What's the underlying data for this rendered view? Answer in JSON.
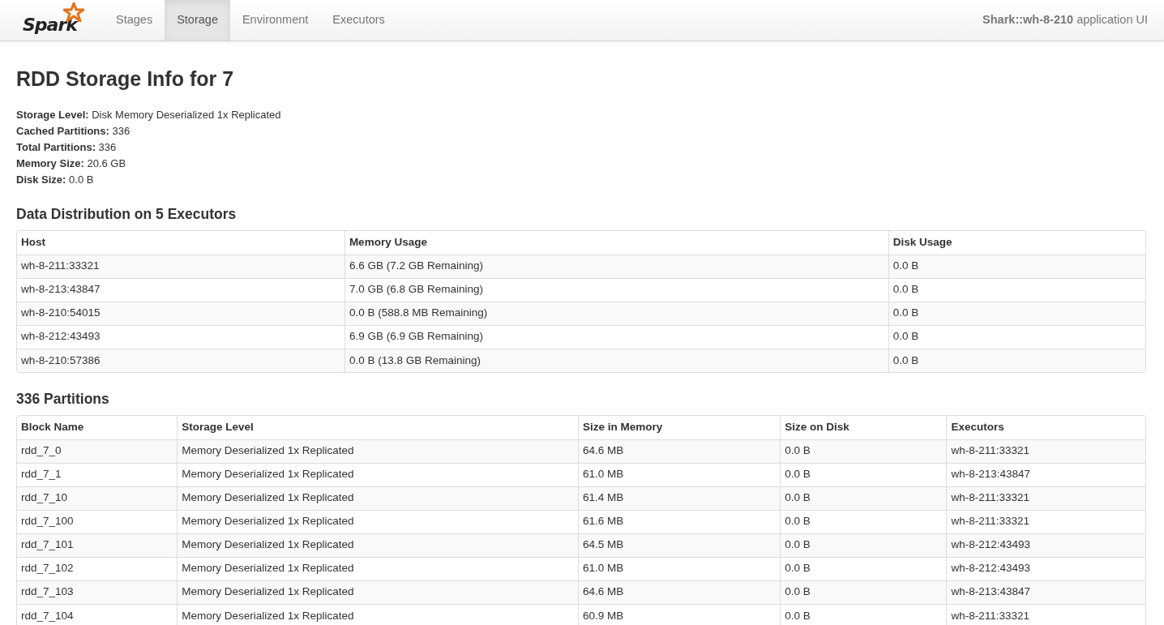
{
  "navbar": {
    "brand": "Spark",
    "tabs": [
      {
        "label": "Stages",
        "selected": false
      },
      {
        "label": "Storage",
        "selected": true
      },
      {
        "label": "Environment",
        "selected": false
      },
      {
        "label": "Executors",
        "selected": false
      }
    ],
    "app_title": "**Shark::wh-8-210** application UI"
  },
  "title": "RDD Storage Info for 7",
  "summary": [
    {
      "label": "Storage Level:",
      "value": "Disk Memory Deserialized 1x Replicated"
    },
    {
      "label": "Cached Partitions:",
      "value": "336"
    },
    {
      "label": "Total Partitions:",
      "value": "336"
    },
    {
      "label": "Memory Size:",
      "value": "20.6 GB"
    },
    {
      "label": "Disk Size:",
      "value": "0.0 B"
    }
  ],
  "executors_table": {
    "heading": "Data Distribution on 5 Executors",
    "columns": [
      "Host",
      "Memory Usage",
      "Disk Usage"
    ],
    "rows": [
      [
        "wh-8-211:33321",
        "6.6 GB (7.2 GB Remaining)",
        "0.0 B"
      ],
      [
        "wh-8-213:43847",
        "7.0 GB (6.8 GB Remaining)",
        "0.0 B"
      ],
      [
        "wh-8-210:54015",
        "0.0 B (588.8 MB Remaining)",
        "0.0 B"
      ],
      [
        "wh-8-212:43493",
        "6.9 GB (6.9 GB Remaining)",
        "0.0 B"
      ],
      [
        "wh-8-210:57386",
        "0.0 B (13.8 GB Remaining)",
        "0.0 B"
      ]
    ]
  },
  "partitions_table": {
    "heading": "336 Partitions",
    "columns": [
      "Block Name",
      "Storage Level",
      "Size in Memory",
      "Size on Disk",
      "Executors"
    ],
    "rows": [
      [
        "rdd_7_0",
        "Memory Deserialized 1x Replicated",
        "64.6 MB",
        "0.0 B",
        "wh-8-211:33321"
      ],
      [
        "rdd_7_1",
        "Memory Deserialized 1x Replicated",
        "61.0 MB",
        "0.0 B",
        "wh-8-213:43847"
      ],
      [
        "rdd_7_10",
        "Memory Deserialized 1x Replicated",
        "61.4 MB",
        "0.0 B",
        "wh-8-211:33321"
      ],
      [
        "rdd_7_100",
        "Memory Deserialized 1x Replicated",
        "61.6 MB",
        "0.0 B",
        "wh-8-211:33321"
      ],
      [
        "rdd_7_101",
        "Memory Deserialized 1x Replicated",
        "64.5 MB",
        "0.0 B",
        "wh-8-212:43493"
      ],
      [
        "rdd_7_102",
        "Memory Deserialized 1x Replicated",
        "61.0 MB",
        "0.0 B",
        "wh-8-212:43493"
      ],
      [
        "rdd_7_103",
        "Memory Deserialized 1x Replicated",
        "64.6 MB",
        "0.0 B",
        "wh-8-213:43847"
      ],
      [
        "rdd_7_104",
        "Memory Deserialized 1x Replicated",
        "60.9 MB",
        "0.0 B",
        "wh-8-211:33321"
      ]
    ]
  }
}
